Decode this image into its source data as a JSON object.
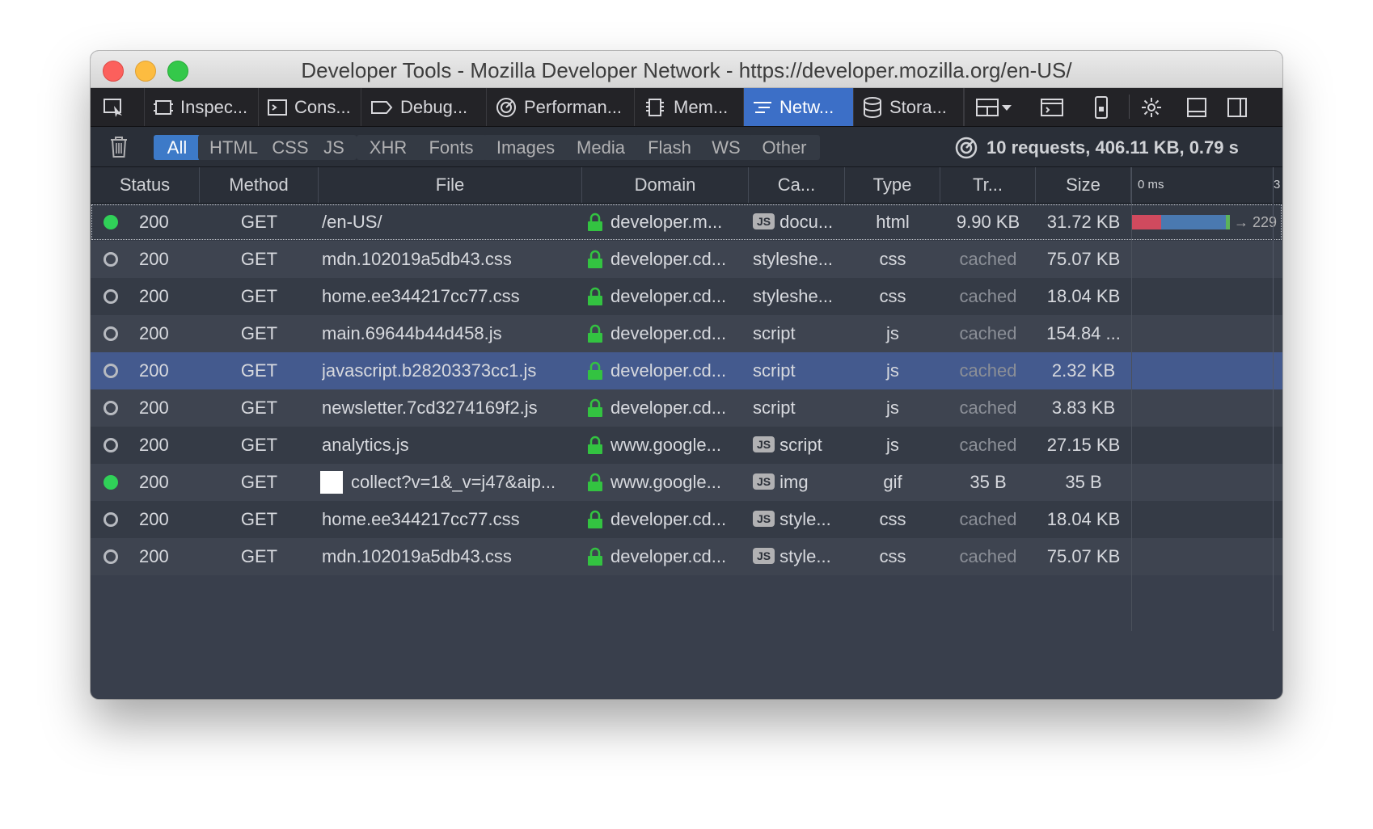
{
  "window": {
    "title": "Developer Tools - Mozilla Developer Network - https://developer.mozilla.org/en-US/"
  },
  "toolbar": {
    "tabs": [
      {
        "label": "Inspec...",
        "icon": "inspector-icon"
      },
      {
        "label": "Cons...",
        "icon": "console-icon"
      },
      {
        "label": "Debug...",
        "icon": "debugger-icon"
      },
      {
        "label": "Performan...",
        "icon": "performance-icon"
      },
      {
        "label": "Mem...",
        "icon": "memory-icon"
      },
      {
        "label": "Netw...",
        "icon": "network-icon",
        "active": true
      },
      {
        "label": "Stora...",
        "icon": "storage-icon"
      }
    ]
  },
  "filters": {
    "buttons": [
      "All",
      "HTML",
      "CSS",
      "JS",
      "XHR",
      "Fonts",
      "Images",
      "Media",
      "Flash",
      "WS",
      "Other"
    ],
    "active": "All",
    "summary": "10 requests, 406.11 KB, 0.79 s"
  },
  "table": {
    "headers": {
      "status": "Status",
      "method": "Method",
      "file": "File",
      "domain": "Domain",
      "cause": "Ca...",
      "type": "Type",
      "transferred": "Tr...",
      "size": "Size",
      "waterfall": "0 ms",
      "waterfall_next": "3"
    },
    "rows": [
      {
        "dot": "green",
        "status": "200",
        "method": "GET",
        "file": "/en-US/",
        "domain": "developer.m...",
        "cause_js": true,
        "cause": "docu...",
        "type": "html",
        "transferred": "9.90 KB",
        "size": "31.72 KB",
        "waterfall_label": "→ 229"
      },
      {
        "dot": "hollow",
        "status": "200",
        "method": "GET",
        "file": "mdn.102019a5db43.css",
        "domain": "developer.cd...",
        "cause_js": false,
        "cause": "styleshe...",
        "type": "css",
        "transferred": "cached",
        "size": "75.07 KB"
      },
      {
        "dot": "hollow",
        "status": "200",
        "method": "GET",
        "file": "home.ee344217cc77.css",
        "domain": "developer.cd...",
        "cause_js": false,
        "cause": "styleshe...",
        "type": "css",
        "transferred": "cached",
        "size": "18.04 KB"
      },
      {
        "dot": "hollow",
        "status": "200",
        "method": "GET",
        "file": "main.69644b44d458.js",
        "domain": "developer.cd...",
        "cause_js": false,
        "cause": "script",
        "type": "js",
        "transferred": "cached",
        "size": "154.84 ..."
      },
      {
        "dot": "hollow",
        "status": "200",
        "method": "GET",
        "file": "javascript.b28203373cc1.js",
        "domain": "developer.cd...",
        "cause_js": false,
        "cause": "script",
        "type": "js",
        "transferred": "cached",
        "size": "2.32 KB",
        "selected": true
      },
      {
        "dot": "hollow",
        "status": "200",
        "method": "GET",
        "file": "newsletter.7cd3274169f2.js",
        "domain": "developer.cd...",
        "cause_js": false,
        "cause": "script",
        "type": "js",
        "transferred": "cached",
        "size": "3.83 KB"
      },
      {
        "dot": "hollow",
        "status": "200",
        "method": "GET",
        "file": "analytics.js",
        "domain": "www.google...",
        "cause_js": true,
        "cause": "script",
        "type": "js",
        "transferred": "cached",
        "size": "27.15 KB"
      },
      {
        "dot": "green",
        "status": "200",
        "method": "GET",
        "file": "collect?v=1&_v=j47&aip...",
        "domain": "www.google...",
        "cause_js": true,
        "cause": "img",
        "type": "gif",
        "transferred": "35 B",
        "size": "35 B",
        "thumb": true
      },
      {
        "dot": "hollow",
        "status": "200",
        "method": "GET",
        "file": "home.ee344217cc77.css",
        "domain": "developer.cd...",
        "cause_js": true,
        "cause": "style...",
        "type": "css",
        "transferred": "cached",
        "size": "18.04 KB"
      },
      {
        "dot": "hollow",
        "status": "200",
        "method": "GET",
        "file": "mdn.102019a5db43.css",
        "domain": "developer.cd...",
        "cause_js": true,
        "cause": "style...",
        "type": "css",
        "transferred": "cached",
        "size": "75.07 KB"
      }
    ]
  },
  "colors": {
    "accent": "#3c6fc7",
    "lock": "#33c341",
    "waterfall_blocked": "#d04a5e",
    "waterfall_wait": "#4a79b0",
    "waterfall_receive": "#5cb35a"
  }
}
